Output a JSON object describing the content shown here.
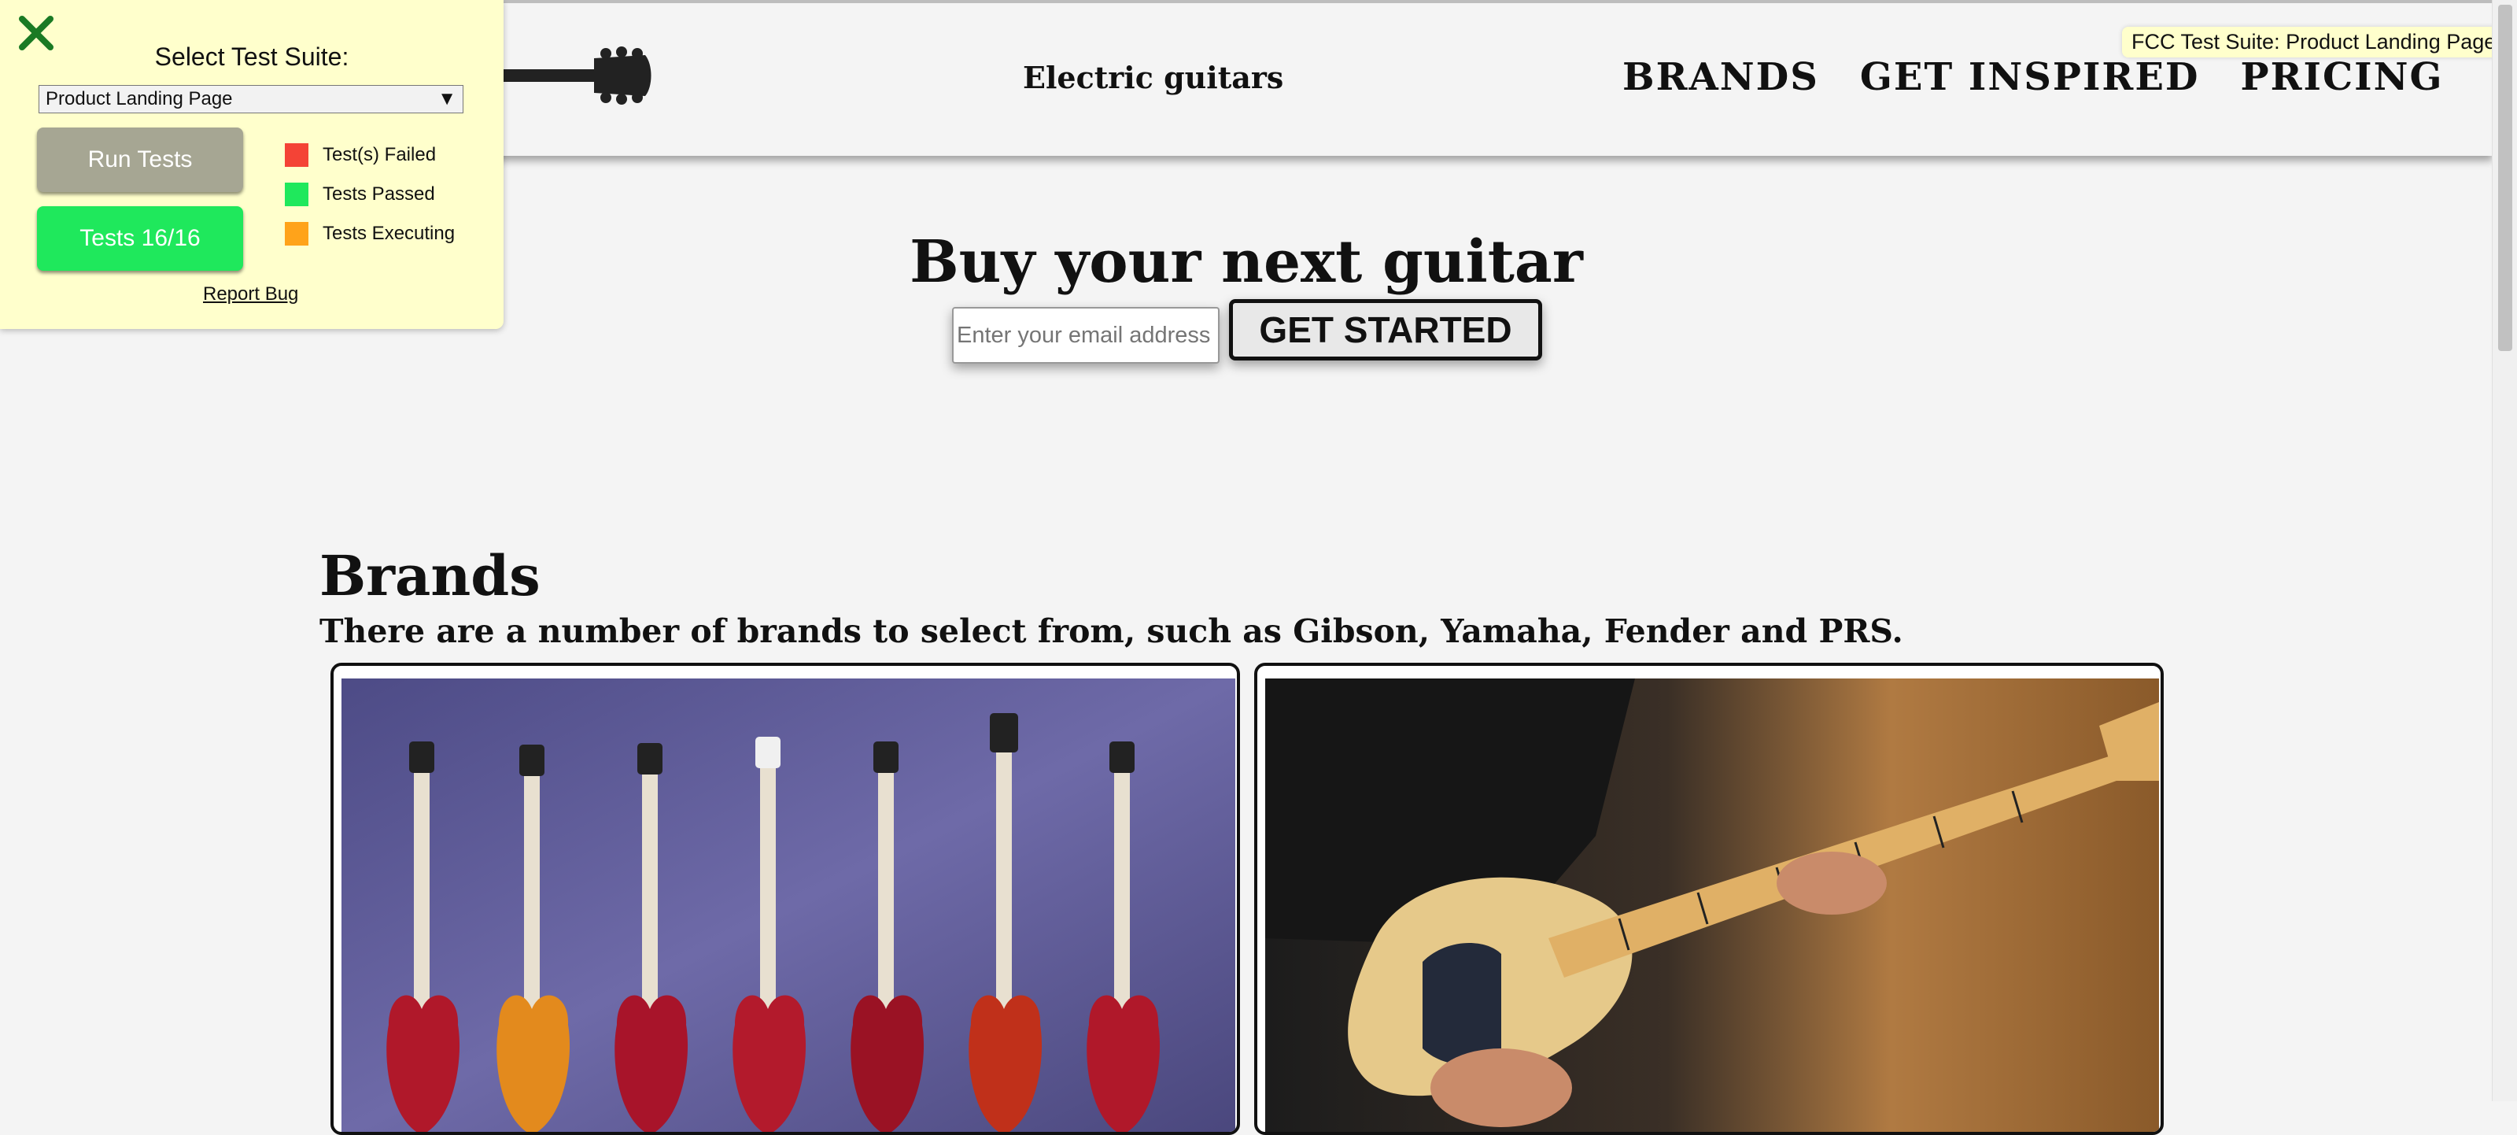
{
  "header": {
    "site_name": "Electric guitars",
    "nav": [
      "BRANDS",
      "GET INSPIRED",
      "PRICING"
    ]
  },
  "tooltip": "FCC Test Suite: Product Landing Page",
  "hero": {
    "title": "Buy your next guitar",
    "email_placeholder": "Enter your email address",
    "cta": "GET STARTED"
  },
  "brands": {
    "title": "Brands",
    "text": "There are a number of brands to select from, such as Gibson, Yamaha, Fender and PRS."
  },
  "fcc": {
    "label": "Select Test Suite:",
    "selected": "Product Landing Page",
    "run_button": "Run Tests",
    "tests_button": "Tests 16/16",
    "legend": [
      {
        "label": "Test(s) Failed",
        "color": "#f44336"
      },
      {
        "label": "Tests Passed",
        "color": "#1fe85c"
      },
      {
        "label": "Tests Executing",
        "color": "#ffa31a"
      }
    ],
    "report_bug": "Report Bug"
  },
  "colors": {
    "background": "#f4f4f4",
    "panel": "#ffffcc",
    "passed": "#1fe85c",
    "close_icon": "#1a7a24"
  }
}
